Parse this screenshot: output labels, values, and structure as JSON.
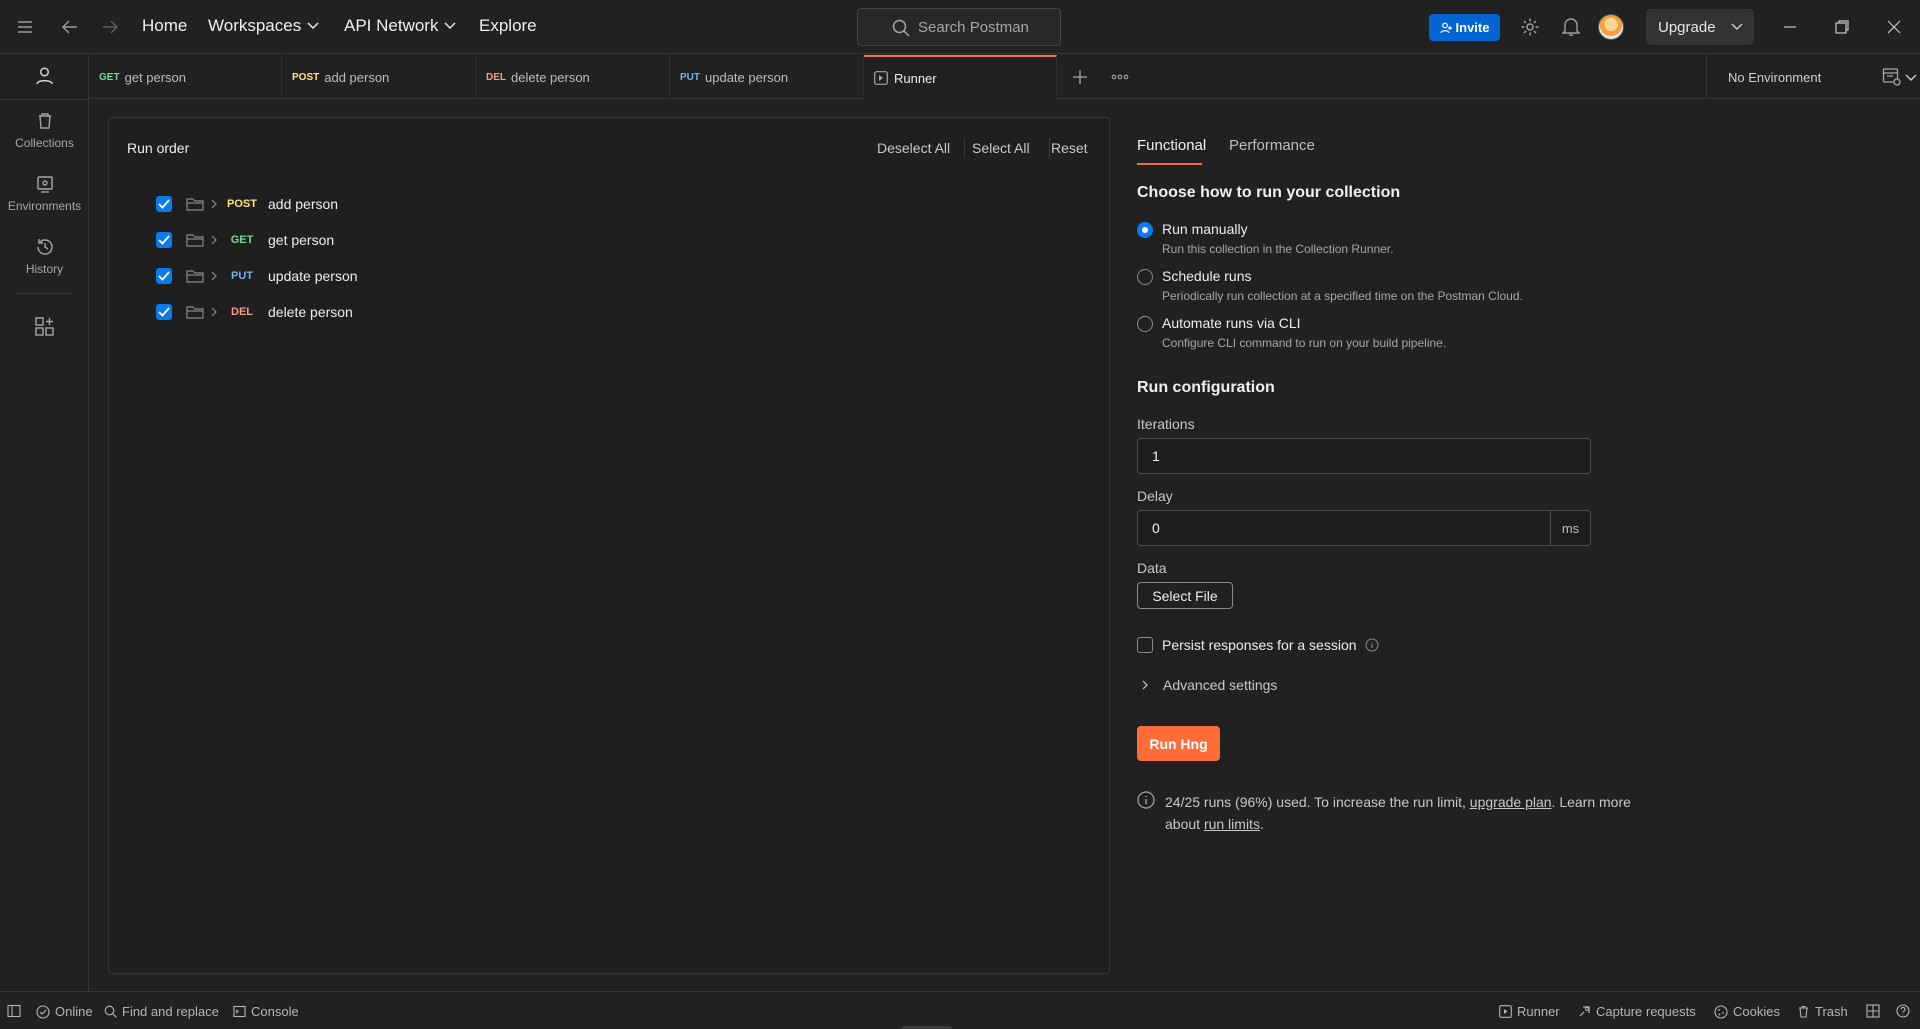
{
  "topbar": {
    "nav": {
      "home": "Home",
      "workspaces": "Workspaces",
      "api_network": "API Network",
      "explore": "Explore"
    },
    "search_placeholder": "Search Postman",
    "invite_label": "Invite",
    "upgrade_label": "Upgrade"
  },
  "sidebar": {
    "items": [
      {
        "label": "Collections",
        "icon": "trash-can-icon"
      },
      {
        "label": "Environments",
        "icon": "environment-icon"
      },
      {
        "label": "History",
        "icon": "history-icon"
      }
    ]
  },
  "tabs": [
    {
      "method": "GET",
      "name": "get person",
      "color": "#6bdd9a"
    },
    {
      "method": "POST",
      "name": "add person",
      "color": "#ffe47e"
    },
    {
      "method": "DEL",
      "name": "delete person",
      "color": "#f79a8e"
    },
    {
      "method": "PUT",
      "name": "update person",
      "color": "#74aef6"
    },
    {
      "name": "Runner"
    }
  ],
  "environment": {
    "selected": "No Environment"
  },
  "run_order": {
    "title": "Run order",
    "actions": {
      "deselect_all": "Deselect All",
      "select_all": "Select All",
      "reset": "Reset"
    },
    "items": [
      {
        "method": "POST",
        "name": "add person",
        "checked": true,
        "color": "#ffe47e"
      },
      {
        "method": "GET",
        "name": "get person",
        "checked": true,
        "color": "#6bdd9a"
      },
      {
        "method": "PUT",
        "name": "update person",
        "checked": true,
        "color": "#74aef6"
      },
      {
        "method": "DEL",
        "name": "delete person",
        "checked": true,
        "color": "#f79a8e"
      }
    ]
  },
  "runner_config": {
    "tabs": {
      "functional": "Functional",
      "performance": "Performance"
    },
    "choose_title": "Choose how to run your collection",
    "options": [
      {
        "title": "Run manually",
        "desc": "Run this collection in the Collection Runner.",
        "selected": true
      },
      {
        "title": "Schedule runs",
        "desc": "Periodically run collection at a specified time on the Postman Cloud.",
        "selected": false
      },
      {
        "title": "Automate runs via CLI",
        "desc": "Configure CLI command to run on your build pipeline.",
        "selected": false
      }
    ],
    "config_title": "Run configuration",
    "iterations_label": "Iterations",
    "iterations_value": "1",
    "delay_label": "Delay",
    "delay_value": "0",
    "delay_unit": "ms",
    "data_label": "Data",
    "select_file": "Select File",
    "persist_label": "Persist responses for a session",
    "persist_checked": false,
    "advanced": "Advanced settings",
    "run_button": "Run Hng",
    "limit_text_1": "24/25 runs (96%) used. To increase the run limit,",
    "limit_link_1": "upgrade plan",
    "limit_text_2": ". Learn more",
    "limit_text_3": "about",
    "limit_link_2": "run limits",
    "limit_text_4": "."
  },
  "statusbar": {
    "online": "Online",
    "find_replace": "Find and replace",
    "console": "Console",
    "runner": "Runner",
    "capture": "Capture requests",
    "cookies": "Cookies",
    "trash": "Trash"
  },
  "colors": {
    "accent": "#ff6c37",
    "primary": "#0265d2",
    "checkbox": "#097bed"
  }
}
